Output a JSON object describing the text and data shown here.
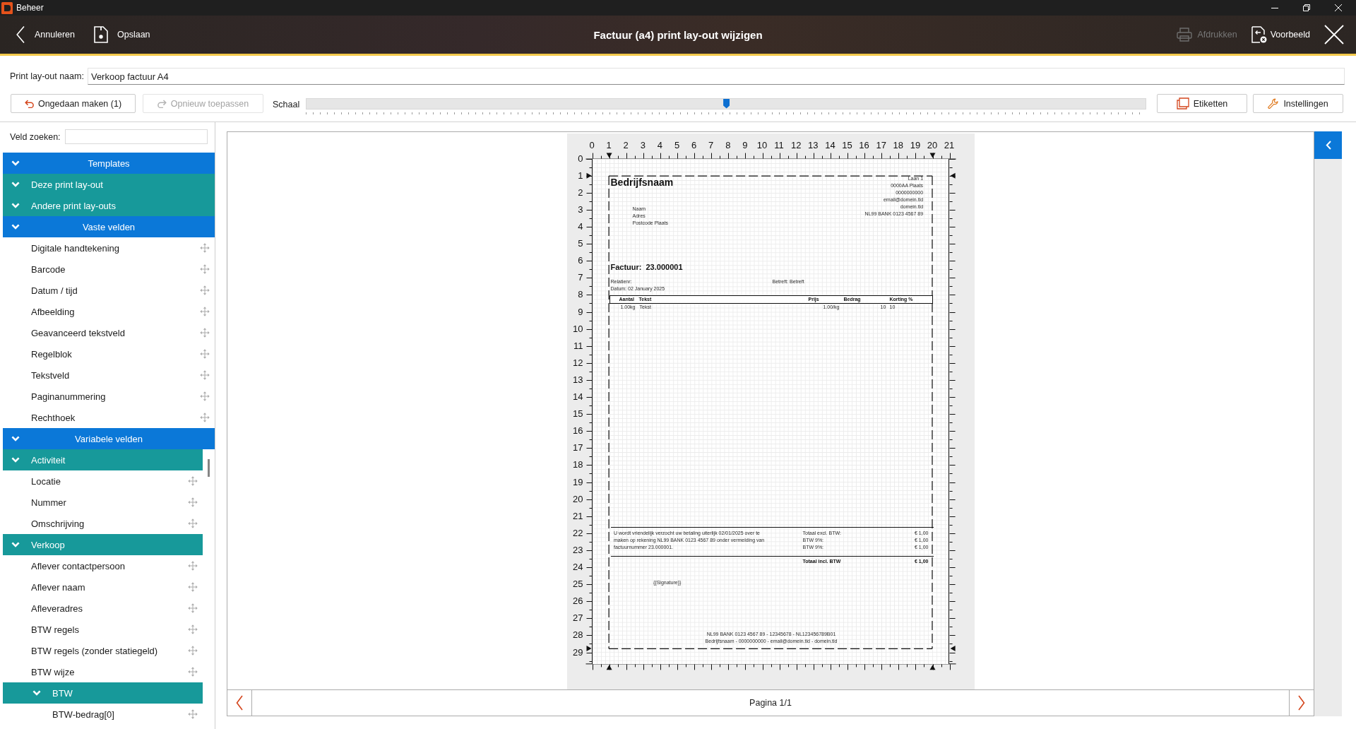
{
  "window": {
    "title": "Beheer"
  },
  "header": {
    "back_button": {
      "label": "Annuleren"
    },
    "save_button": {
      "label": "Opslaan"
    },
    "title": "Factuur (a4) print lay-out wijzigen",
    "print_button": {
      "label": "Afdrukken",
      "disabled": true
    },
    "preview_button": {
      "label": "Voorbeeld",
      "disabled": false
    }
  },
  "layout_name": {
    "label": "Print lay-out naam:",
    "value": "Verkoop factuur A4"
  },
  "toolbar": {
    "undo_button": {
      "label": "Ongedaan maken (1)",
      "disabled": false
    },
    "redo_button": {
      "label": "Opnieuw toepassen",
      "disabled": true
    },
    "scale": {
      "label": "Schaal",
      "level": 0.5
    },
    "labels_button": {
      "label": "Etiketten"
    },
    "settings_button": {
      "label": "Instellingen"
    }
  },
  "sidebar": {
    "search": {
      "label": "Veld zoeken:"
    },
    "tree": [
      {
        "kind": "section",
        "label": "Templates",
        "expanded": true,
        "children": [
          {
            "kind": "group",
            "label": "Deze print lay-out",
            "expanded": true
          },
          {
            "kind": "group",
            "label": "Andere print lay-outs",
            "expanded": true
          }
        ]
      },
      {
        "kind": "section",
        "label": "Vaste velden",
        "expanded": true,
        "children": [
          {
            "kind": "field",
            "label": "Digitale handtekening"
          },
          {
            "kind": "field",
            "label": "Barcode"
          },
          {
            "kind": "field",
            "label": "Datum / tijd"
          },
          {
            "kind": "field",
            "label": "Afbeelding"
          },
          {
            "kind": "field",
            "label": "Geavanceerd tekstveld"
          },
          {
            "kind": "field",
            "label": "Regelblok"
          },
          {
            "kind": "field",
            "label": "Tekstveld"
          },
          {
            "kind": "field",
            "label": "Paginanummering"
          },
          {
            "kind": "field",
            "label": "Rechthoek"
          }
        ]
      },
      {
        "kind": "section",
        "label": "Variabele velden",
        "expanded": true,
        "children": [
          {
            "kind": "group",
            "label": "Activiteit",
            "expanded": true,
            "children": [
              {
                "kind": "field",
                "label": "Locatie"
              },
              {
                "kind": "field",
                "label": "Nummer"
              },
              {
                "kind": "field",
                "label": "Omschrijving"
              }
            ]
          },
          {
            "kind": "group",
            "label": "Verkoop",
            "expanded": true,
            "children": [
              {
                "kind": "field",
                "label": "Aflever contactpersoon"
              },
              {
                "kind": "field",
                "label": "Aflever naam"
              },
              {
                "kind": "field",
                "label": "Afleveradres"
              },
              {
                "kind": "field",
                "label": "BTW regels"
              },
              {
                "kind": "field",
                "label": "BTW regels (zonder statiegeld)"
              },
              {
                "kind": "field",
                "label": "BTW wijze"
              },
              {
                "kind": "group",
                "label": "BTW",
                "expanded": true,
                "children": [
                  {
                    "kind": "field",
                    "label": "BTW-bedrag[0]"
                  }
                ]
              }
            ]
          }
        ]
      }
    ]
  },
  "designer": {
    "rulers": {
      "horizontal": [
        "0",
        "1",
        "2",
        "3",
        "4",
        "5",
        "6",
        "7",
        "8",
        "9",
        "10",
        "11",
        "12",
        "13",
        "14",
        "15",
        "16",
        "17",
        "18",
        "19",
        "20",
        "21"
      ],
      "vertical": [
        "0",
        "1",
        "2",
        "3",
        "4",
        "5",
        "6",
        "7",
        "8",
        "9",
        "10",
        "11",
        "12",
        "13",
        "14",
        "15",
        "16",
        "17",
        "18",
        "19",
        "20",
        "21",
        "22",
        "23",
        "24",
        "25",
        "26",
        "27",
        "28",
        "29"
      ]
    },
    "document": {
      "company_name": "Bedrijfsnaam",
      "sender_lines": [
        "Laan 1",
        "0000AA Plaats",
        "0000000000",
        "email@domein.tld",
        "domein.tld",
        "NL99 BANK 0123 4567 89"
      ],
      "recipient_lines": [
        "Naam",
        "Adres",
        "Postcode Plaats"
      ],
      "invoice_label": "Factuur:",
      "invoice_number": "23.000001",
      "relation_line": "Relatienr:",
      "date_line": "Datum: 02 January 2025",
      "subject_line": "Betreft: Betreft",
      "table": {
        "columns": [
          "Aantal",
          "Tekst",
          "Prijs",
          "Bedrag",
          "Korting %"
        ],
        "rows": [
          [
            "1.00kg",
            "Tekst",
            "1.00/kg",
            "10",
            "10"
          ]
        ]
      },
      "payment_note": "U wordt vriendelijk verzocht uw betaling uiterlijk 02/01/2025 over te maken op rekening NL99 BANK 0123 4567 89 onder vermelding van factuurnummer 23.000001.",
      "totals": [
        {
          "label": "Totaal excl. BTW:",
          "amount": "€ 1,00"
        },
        {
          "label": "BTW 9%:",
          "amount": "€ 1,00"
        },
        {
          "label": "BTW 9%:",
          "amount": "€ 1,00"
        }
      ],
      "grand_total": {
        "label": "Totaal incl. BTW",
        "amount": "€ 1,00"
      },
      "signature": "{{Signature}}",
      "footer_lines": [
        "NL99 BANK 0123 4567 89 - 12345678 - NL123456789B01",
        "Bedrijfsnaam - 0000000000 - email@domein.tld - domein.tld"
      ]
    }
  },
  "pager": {
    "label": "Pagina 1/1"
  }
}
